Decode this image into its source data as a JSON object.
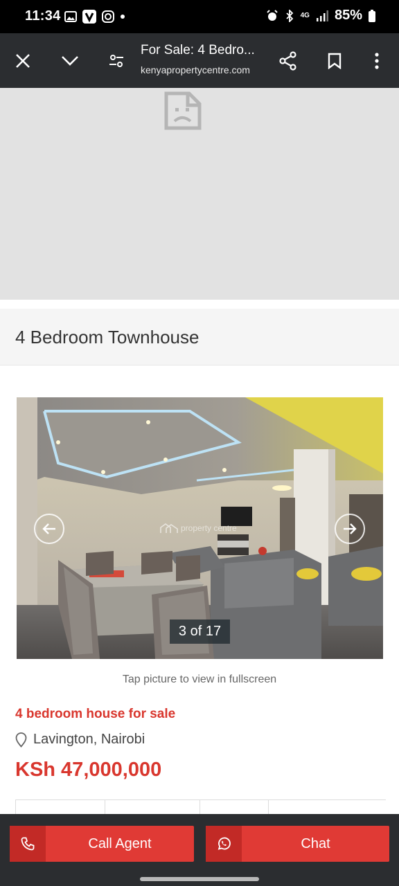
{
  "status_bar": {
    "time": "11:34",
    "network": "4G",
    "battery": "85%"
  },
  "toolbar": {
    "title": "For Sale: 4 Bedro...",
    "url": "kenyapropertycentre.com"
  },
  "page": {
    "title": "4 Bedroom Townhouse",
    "photo_counter": "3 of 17",
    "watermark": "property centre",
    "caption": "Tap picture to view in fullscreen",
    "listing_heading": "4 bedroom house for sale",
    "location": "Lavington, Nairobi",
    "price": "KSh 47,000,000"
  },
  "actions": {
    "call_label": "Call Agent",
    "chat_label": "Chat"
  },
  "colors": {
    "accent": "#e03a35",
    "toolbar": "#2b2d30"
  }
}
